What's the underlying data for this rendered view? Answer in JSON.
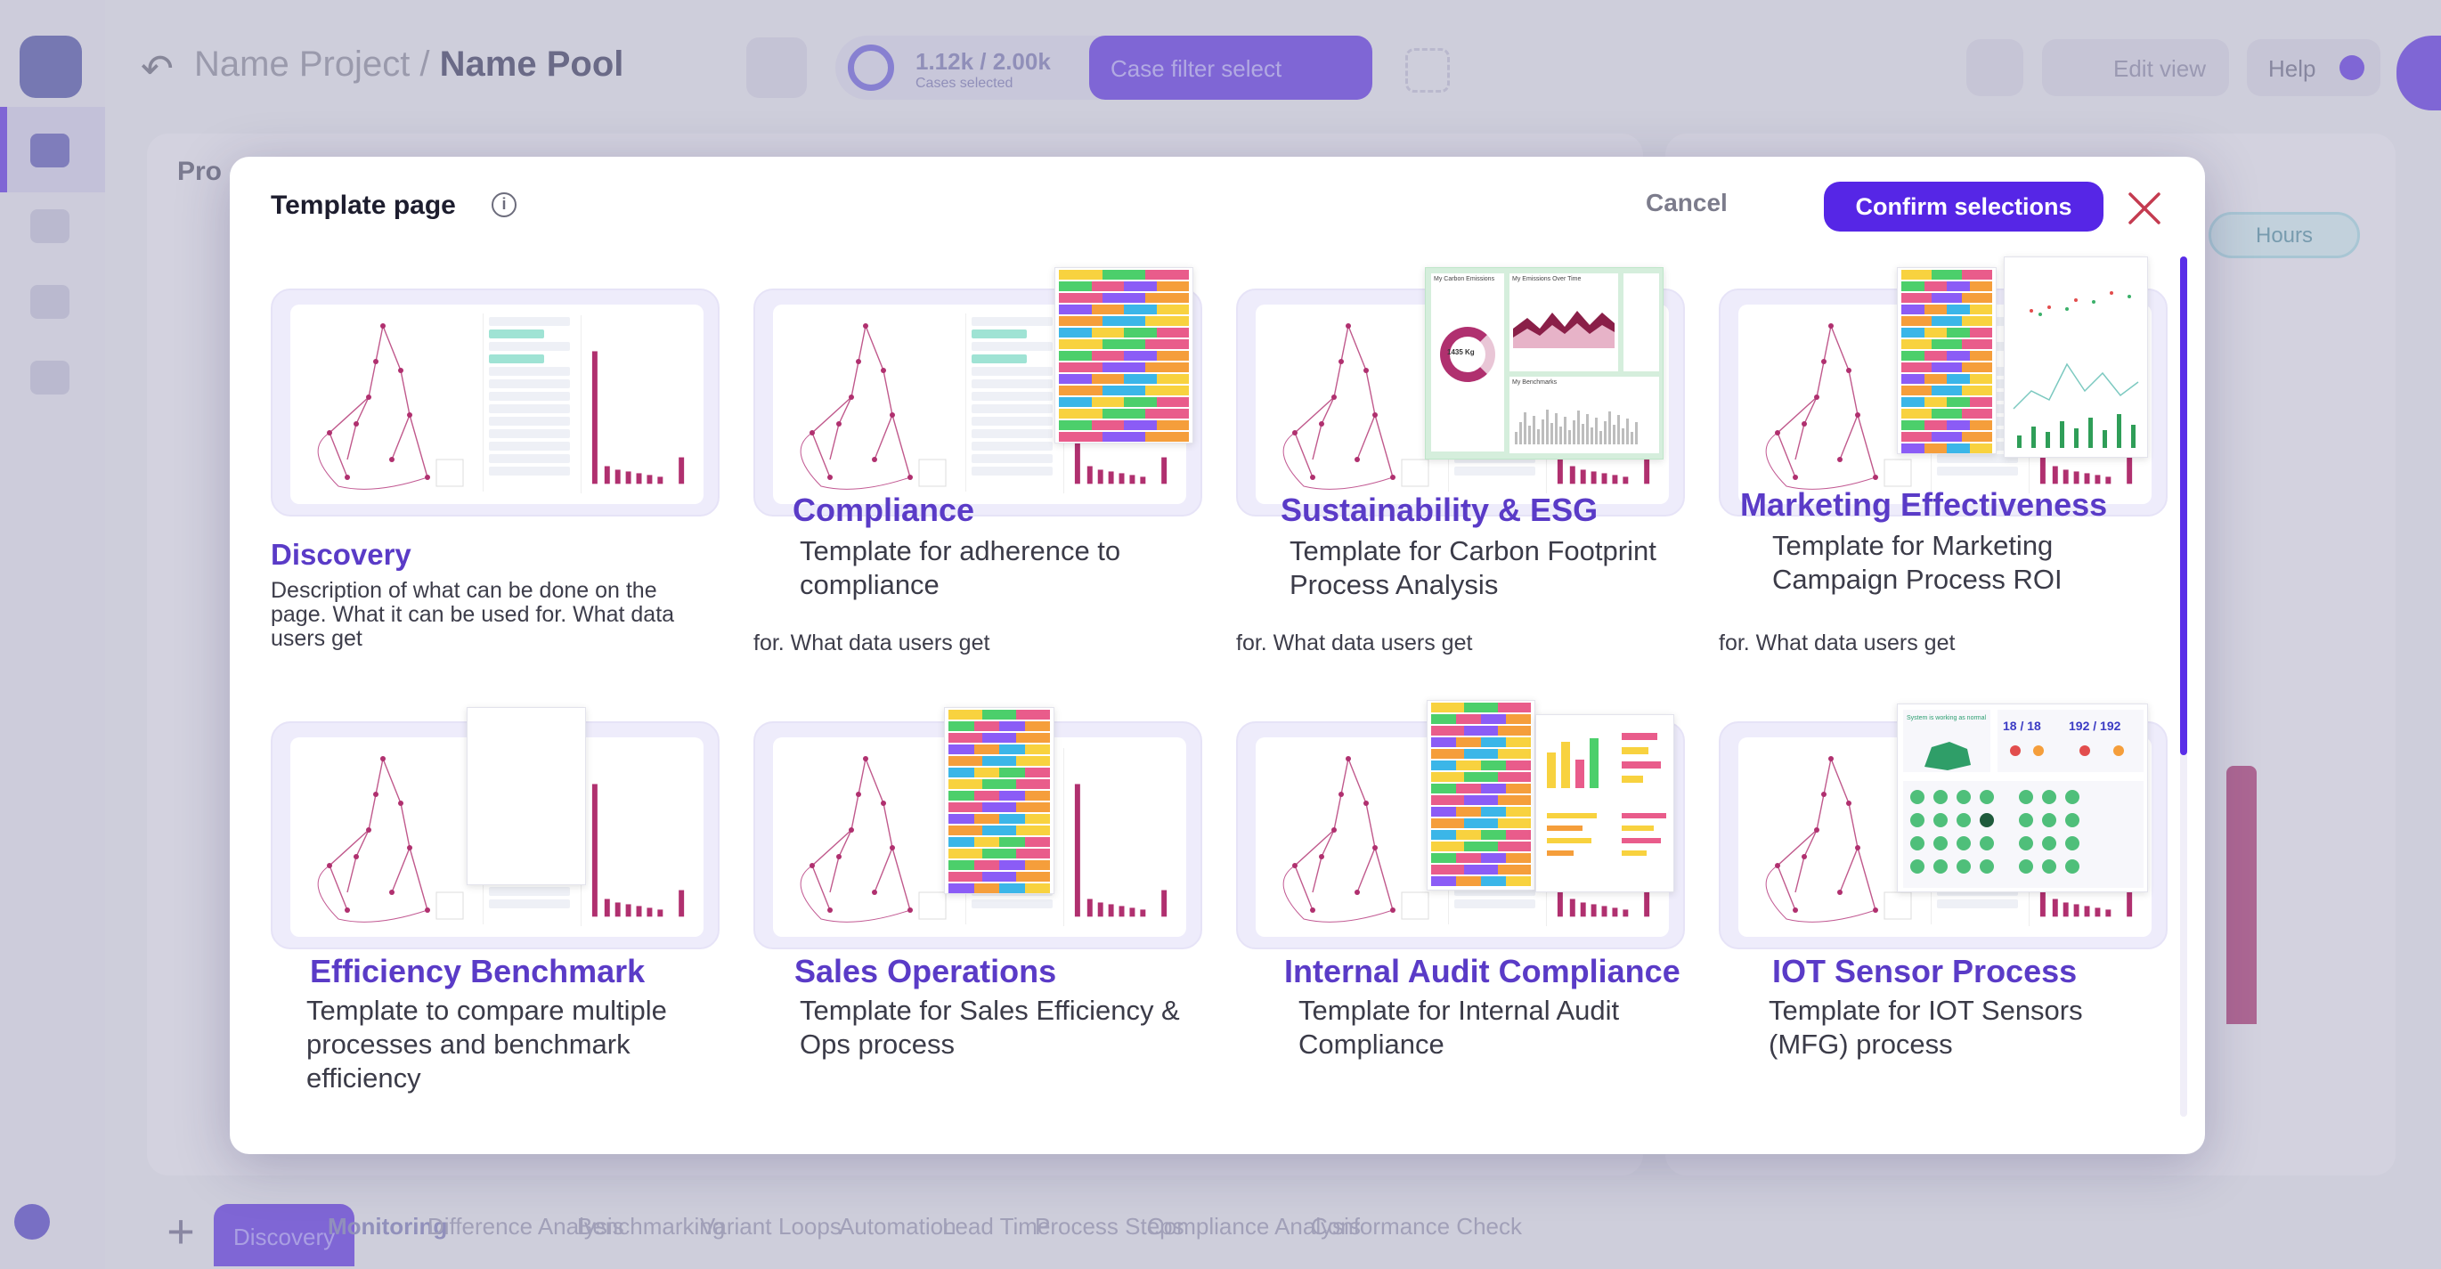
{
  "app": {
    "project_name": "Name Project",
    "separator": " / ",
    "pool_name": "Name Pool",
    "cases_count": "1.12k / 2.00k",
    "cases_label": "Cases selected",
    "counter_percent": "48%",
    "filter_button": "Case filter select",
    "edit_view": "Edit view",
    "help": "Help",
    "hours_pill": "Hours",
    "panel_label": "Pro",
    "tabs": [
      {
        "label": "Discovery"
      },
      {
        "label": "Monitoring"
      },
      {
        "label": "Difference Analysis"
      },
      {
        "label": "Benchmarking"
      },
      {
        "label": "Variant"
      },
      {
        "label": "Loops"
      },
      {
        "label": "Automation"
      },
      {
        "label": "Lead Time"
      },
      {
        "label": "Process Steps"
      },
      {
        "label": "Compliance Analysis"
      },
      {
        "label": "Conformance Check"
      }
    ]
  },
  "modal": {
    "title": "Template page",
    "cancel": "Cancel",
    "confirm": "Confirm selections",
    "ghost_text": "for. What data users get",
    "cards": [
      {
        "title": "Discovery",
        "description": "Description of what can be done on the page. What it can be used for. What data users get"
      },
      {
        "title": "Compliance",
        "description": "Template for adherence to compliance"
      },
      {
        "title": "Sustainability & ESG",
        "description": "Template for Carbon Footprint Process Analysis",
        "carbon_value": "1435 Kg",
        "chart_titles": [
          "My Carbon Emissions",
          "My Emissions Over Time",
          "My Benchmarks"
        ]
      },
      {
        "title": "Marketing Effectiveness",
        "description": "Template for Marketing Campaign Process ROI"
      },
      {
        "title": "Efficiency Benchmark",
        "description": "Template to compare multiple processes and benchmark efficiency"
      },
      {
        "title": "Sales Operations",
        "description": "Template for Sales Efficiency & Ops  process"
      },
      {
        "title": "Internal Audit Compliance",
        "description": "Template for Internal Audit Compliance"
      },
      {
        "title": "IOT Sensor Process",
        "description": "Template for IOT Sensors (MFG)  process",
        "sensor_a": "18 / 18",
        "sensor_b": "192 / 192",
        "status": "System is working as normal"
      }
    ]
  },
  "colors": {
    "accent": "#5626e6",
    "title_purple": "#5a3bc7",
    "graph_pink": "#b0306f",
    "stack": [
      "#f8d23f",
      "#4ccf6b",
      "#e95c8b",
      "#8b5cf6",
      "#f59e3b",
      "#3bb6e8"
    ]
  }
}
